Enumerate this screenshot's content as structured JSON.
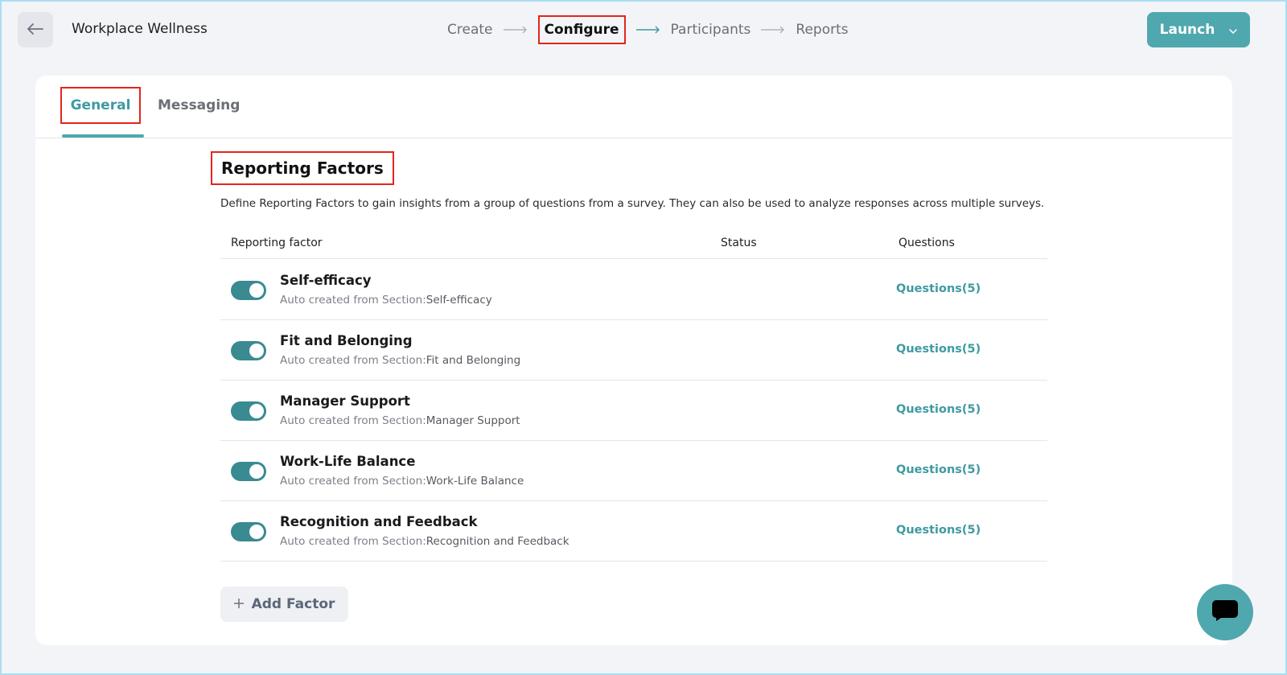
{
  "header": {
    "back_icon": "arrow-left-icon",
    "title": "Workplace Wellness",
    "steps": [
      "Create",
      "Configure",
      "Participants",
      "Reports"
    ],
    "active_step": "Configure",
    "launch_label": "Launch",
    "launch_icon": "chevron-down-icon"
  },
  "tabs": {
    "general": "General",
    "messaging": "Messaging",
    "active": "General"
  },
  "section": {
    "title": "Reporting Factors",
    "description": "Define Reporting Factors to gain insights from a group of questions from a survey. They can also be used to analyze responses across multiple surveys."
  },
  "table": {
    "headers": {
      "factor": "Reporting factor",
      "status": "Status",
      "questions": "Questions"
    },
    "rows": [
      {
        "name": "Self-efficacy",
        "sub_prefix": "Auto created from Section:",
        "source": "Self-efficacy",
        "enabled": true,
        "questions": "Questions(5)"
      },
      {
        "name": "Fit and Belonging",
        "sub_prefix": "Auto created from Section:",
        "source": "Fit and Belonging",
        "enabled": true,
        "questions": "Questions(5)"
      },
      {
        "name": "Manager Support",
        "sub_prefix": "Auto created from Section:",
        "source": "Manager Support",
        "enabled": true,
        "questions": "Questions(5)"
      },
      {
        "name": "Work-Life Balance",
        "sub_prefix": "Auto created from Section:",
        "source": "Work-Life Balance",
        "enabled": true,
        "questions": "Questions(5)"
      },
      {
        "name": "Recognition and Feedback",
        "sub_prefix": "Auto created from Section:",
        "source": "Recognition and Feedback",
        "enabled": true,
        "questions": "Questions(5)"
      }
    ]
  },
  "add_factor": {
    "icon": "plus-icon",
    "label": "Add Factor"
  },
  "chat": {
    "icon": "chat-bubble-icon"
  },
  "colors": {
    "accent": "#4fa8ae",
    "toggle_on": "#3a8a91",
    "highlight_border": "#e3261b"
  }
}
